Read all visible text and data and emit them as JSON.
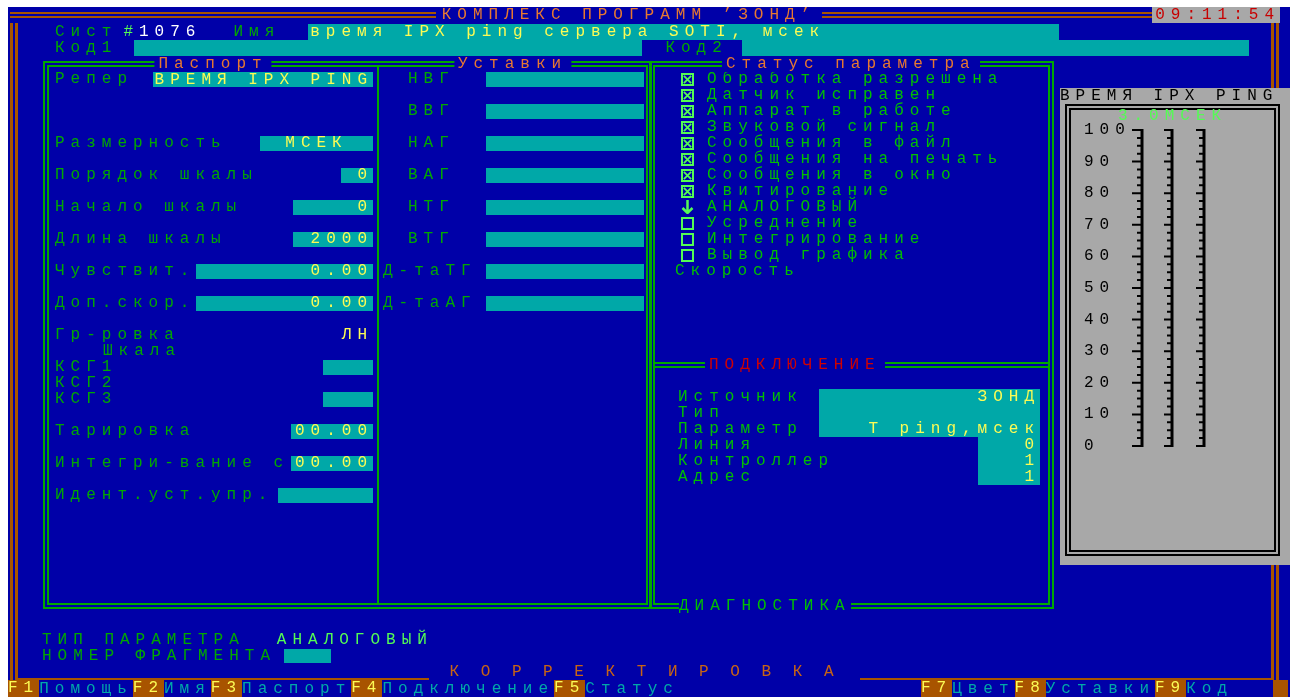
{
  "title": "КОМПЛЕКС ПРОГРАММ ’ЗОНД’",
  "clock": "09:11:54",
  "header": {
    "system_label": "Сист",
    "system_mark": "#",
    "system_number": "1076",
    "name_label": "Имя",
    "name_value": "время IPX ping сервера SOTI, мсек",
    "code1_label": "Код1",
    "code2_label": "Код2"
  },
  "passport": {
    "title": "Паспорт",
    "reper_label": "Репер",
    "reper_value": "ВРЕМЯ IPX PING",
    "rows": [
      {
        "kind": "field",
        "label": "Размерность",
        "value": "МСЕК"
      },
      {
        "kind": "field",
        "label": "Порядок шкалы",
        "value": "0"
      },
      {
        "kind": "field",
        "label": "Начало шкалы",
        "value": "0"
      },
      {
        "kind": "field",
        "label": "Длина шкалы",
        "value": "2000"
      },
      {
        "kind": "field",
        "label": "Чувствит.",
        "value": "0.00"
      },
      {
        "kind": "field",
        "label": "Доп.скор.",
        "value": "0.00"
      },
      {
        "kind": "text",
        "label": "Гр-ровка",
        "value": "ЛН"
      },
      {
        "kind": "subhead",
        "label": "Шкала"
      },
      {
        "kind": "field",
        "label": "КСГ1"
      },
      {
        "kind": "label",
        "label": "КСГ2"
      },
      {
        "kind": "field",
        "label": "КСГ3"
      },
      {
        "kind": "field",
        "label": "Тарировка",
        "value": "00.00"
      },
      {
        "kind": "field",
        "label": "Интегри-вание с",
        "value": "00.00"
      },
      {
        "kind": "field",
        "label": "Идент.уст.упр."
      }
    ]
  },
  "setpoints": {
    "title": "Уставки",
    "rows": [
      {
        "label": "НВГ"
      },
      {
        "label": "ВВГ"
      },
      {
        "label": "НАГ"
      },
      {
        "label": "ВАГ"
      },
      {
        "label": "НТГ"
      },
      {
        "label": "ВТГ"
      },
      {
        "label": "Д-таТГ"
      },
      {
        "label": "Д-таАГ"
      }
    ]
  },
  "status": {
    "title": "Статус параметра",
    "rows": [
      {
        "kind": "check",
        "label": "Обработка разрешена",
        "checked": true
      },
      {
        "kind": "check",
        "label": "Датчик исправен",
        "checked": true
      },
      {
        "kind": "check",
        "label": "Аппарат в работе",
        "checked": true
      },
      {
        "kind": "check",
        "label": "Звуковой сигнал",
        "checked": true
      },
      {
        "kind": "check",
        "label": "Сообщения в файл",
        "checked": true
      },
      {
        "kind": "check",
        "label": "Сообщения на печать",
        "checked": true
      },
      {
        "kind": "check",
        "label": "Сообщения в окно",
        "checked": true
      },
      {
        "kind": "check",
        "label": "Квитирование",
        "checked": true
      },
      {
        "kind": "arrow",
        "label": "АНАЛОГОВЫЙ"
      },
      {
        "kind": "check",
        "label": "Усреднение",
        "checked": false
      },
      {
        "kind": "check",
        "label": "Интегрирование",
        "checked": false
      },
      {
        "kind": "check",
        "label": "Вывод графика",
        "checked": false
      },
      {
        "kind": "plain",
        "label": "Скорость"
      }
    ]
  },
  "connection": {
    "title": "ПОДКЛЮЧЕНИЕ",
    "rows": [
      {
        "kind": "wide",
        "label": "Источник",
        "value": "ЗОНД"
      },
      {
        "kind": "wide",
        "label": "Тип"
      },
      {
        "kind": "wide",
        "label": "Параметр",
        "value": "T ping,мсек"
      },
      {
        "kind": "narrow",
        "label": "Линия",
        "value": "0"
      },
      {
        "kind": "narrow",
        "label": "Контроллер",
        "value": "1"
      },
      {
        "kind": "narrow",
        "label": "Адрес",
        "value": "1"
      }
    ]
  },
  "diagnostics_title": "ДИАГНОСТИКА",
  "gauge": {
    "title": "ВРЕМЯ IPX PING",
    "reading": "3.0МСЕК",
    "scale_labels": [
      "100",
      "90",
      "80",
      "70",
      "60",
      "50",
      "40",
      "30",
      "20",
      "10",
      "0"
    ]
  },
  "bottom": {
    "param_type_label": "ТИП ПАРАМЕТРА",
    "param_type_value": "АНАЛОГОВЫЙ",
    "fragment_label": "НОМЕР ФРАГМЕНТА"
  },
  "mode_title": "К О Р Р Е К Т И Р О В К А",
  "function_keys_left": [
    {
      "key": "F1",
      "label": "Помощь"
    },
    {
      "key": "F2",
      "label": "Имя"
    },
    {
      "key": "F3",
      "label": "Паспорт"
    },
    {
      "key": "F4",
      "label": "Подключение"
    },
    {
      "key": "F5",
      "label": "Статус"
    }
  ],
  "function_keys_right": [
    {
      "key": "F7",
      "label": "Цвет"
    },
    {
      "key": "F8",
      "label": "Уставки"
    },
    {
      "key": "F9",
      "label": "Код"
    }
  ]
}
